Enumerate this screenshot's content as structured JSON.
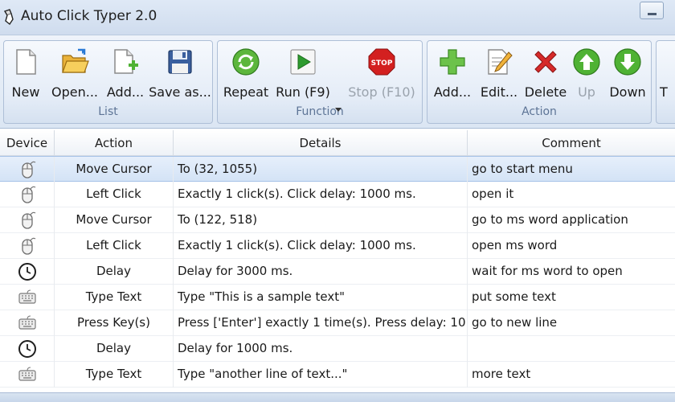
{
  "window": {
    "title": "Auto Click Typer 2.0"
  },
  "ribbon": {
    "groups": [
      {
        "label": "List",
        "buttons": [
          {
            "label": "New",
            "icon": "new-file-icon"
          },
          {
            "label": "Open...",
            "icon": "open-folder-icon"
          },
          {
            "label": "Add...",
            "icon": "add-file-icon"
          },
          {
            "label": "Save as...",
            "icon": "floppy-disk-icon"
          }
        ]
      },
      {
        "label": "Function",
        "buttons": [
          {
            "label": "Repeat",
            "icon": "repeat-icon"
          },
          {
            "label": "Run (F9)",
            "icon": "play-icon"
          },
          {
            "label": "Stop (F10)",
            "icon": "stop-sign-icon",
            "disabled": true
          }
        ]
      },
      {
        "label": "Action",
        "buttons": [
          {
            "label": "Add...",
            "icon": "plus-icon"
          },
          {
            "label": "Edit...",
            "icon": "edit-icon"
          },
          {
            "label": "Delete",
            "icon": "delete-x-icon"
          },
          {
            "label": "Up",
            "icon": "arrow-up-icon",
            "disabled": true
          },
          {
            "label": "Down",
            "icon": "arrow-down-icon"
          }
        ]
      },
      {
        "label": "",
        "buttons": [
          {
            "label": "T",
            "icon": ""
          }
        ]
      }
    ]
  },
  "table": {
    "columns": [
      "Device",
      "Action",
      "Details",
      "Comment"
    ],
    "rows": [
      {
        "device": "mouse",
        "action": "Move Cursor",
        "details": "To (32, 1055)",
        "comment": "go to start menu",
        "selected": true
      },
      {
        "device": "mouse",
        "action": "Left Click",
        "details": "Exactly 1 click(s). Click delay: 1000 ms.",
        "comment": "open it"
      },
      {
        "device": "mouse",
        "action": "Move Cursor",
        "details": "To (122, 518)",
        "comment": "go to ms word application"
      },
      {
        "device": "mouse",
        "action": "Left Click",
        "details": "Exactly 1 click(s). Click delay: 1000 ms.",
        "comment": "open ms word"
      },
      {
        "device": "clock",
        "action": "Delay",
        "details": "Delay for 3000 ms.",
        "comment": "wait for ms word to open"
      },
      {
        "device": "keyboard",
        "action": "Type Text",
        "details": "Type \"This is a sample text\"",
        "comment": "put some text"
      },
      {
        "device": "keyboard",
        "action": "Press Key(s)",
        "details": "Press ['Enter'] exactly 1 time(s). Press delay: 10...",
        "comment": "go to new line"
      },
      {
        "device": "clock",
        "action": "Delay",
        "details": "Delay for 1000 ms.",
        "comment": ""
      },
      {
        "device": "keyboard",
        "action": "Type Text",
        "details": "Type \"another line of text...\"",
        "comment": "more text"
      }
    ]
  },
  "colors": {
    "accent": "#5d7496",
    "selection": "#d4e3f6",
    "play": "#2e9b2e",
    "stop": "#d32020",
    "plus": "#5cb63c"
  }
}
